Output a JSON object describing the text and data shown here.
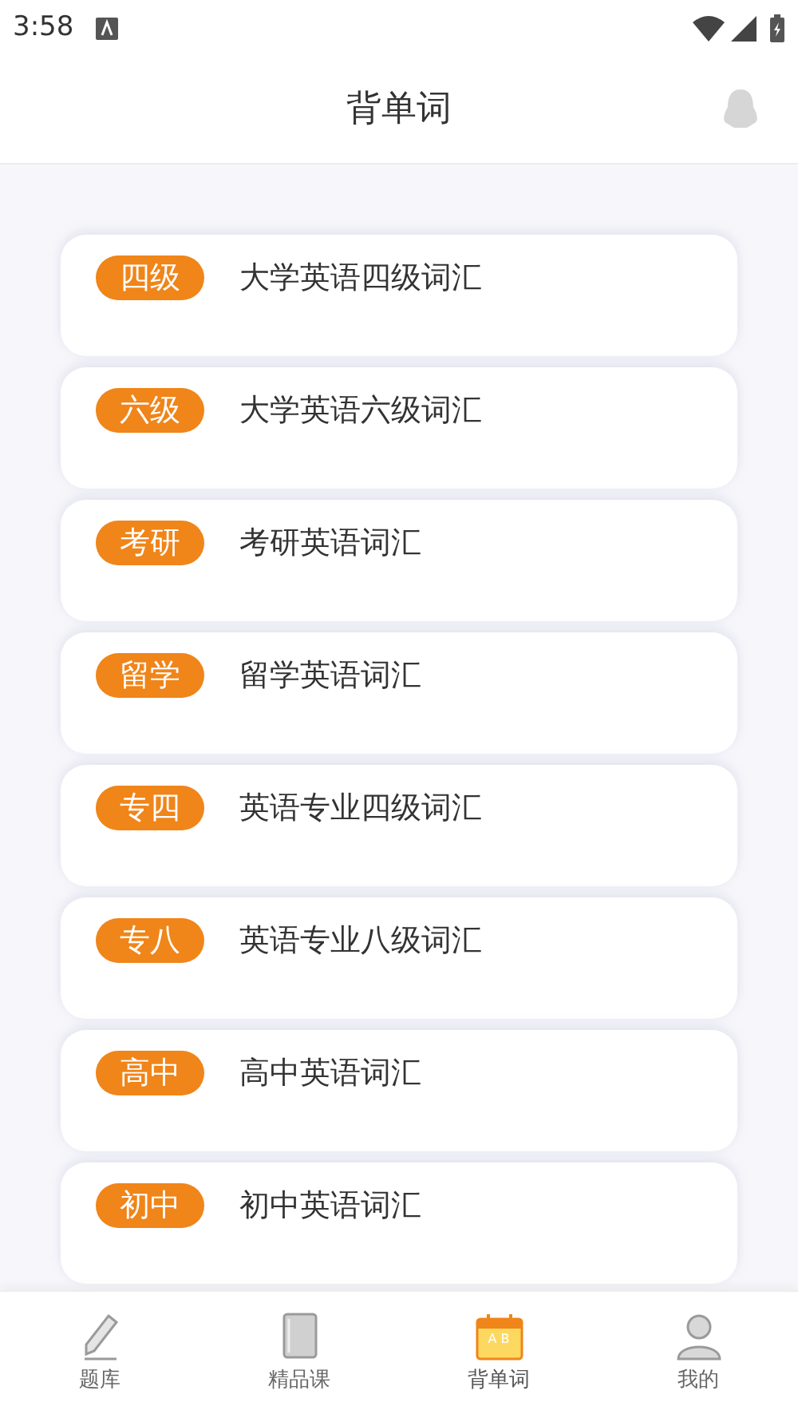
{
  "status_bar": {
    "time": "3:58"
  },
  "header": {
    "title": "背单词"
  },
  "word_lists": [
    {
      "tag": "四级",
      "title": "大学英语四级词汇"
    },
    {
      "tag": "六级",
      "title": "大学英语六级词汇"
    },
    {
      "tag": "考研",
      "title": "考研英语词汇"
    },
    {
      "tag": "留学",
      "title": "留学英语词汇"
    },
    {
      "tag": "专四",
      "title": "英语专业四级词汇"
    },
    {
      "tag": "专八",
      "title": "英语专业八级词汇"
    },
    {
      "tag": "高中",
      "title": "高中英语词汇"
    },
    {
      "tag": "初中",
      "title": "初中英语词汇"
    }
  ],
  "tab_bar": [
    {
      "label": "题库",
      "kind": "pencil",
      "selected": false
    },
    {
      "label": "精品课",
      "kind": "book",
      "selected": false
    },
    {
      "label": "背单词",
      "kind": "calendar",
      "selected": true,
      "icon_text": "A B"
    },
    {
      "label": "我的",
      "kind": "person",
      "selected": false
    }
  ]
}
